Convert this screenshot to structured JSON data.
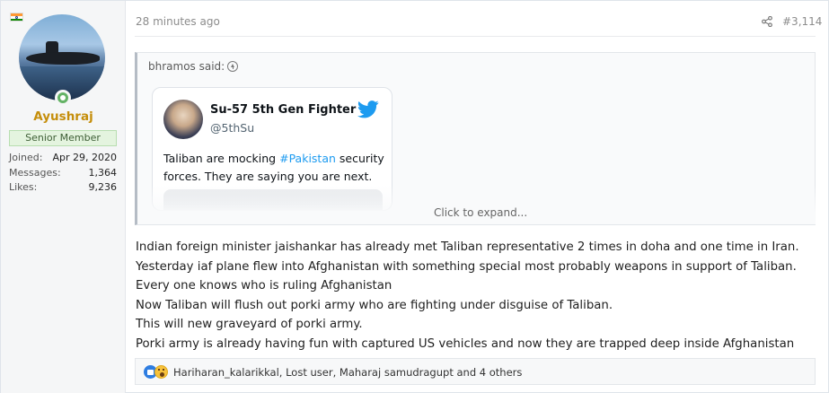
{
  "user": {
    "username": "Ayushraj",
    "title": "Senior Member",
    "stats": [
      {
        "label": "Joined:",
        "value": "Apr 29, 2020"
      },
      {
        "label": "Messages:",
        "value": "1,364"
      },
      {
        "label": "Likes:",
        "value": "9,236"
      }
    ],
    "flag": "india-flag-icon"
  },
  "post": {
    "time": "28 minutes ago",
    "number": "#3,114"
  },
  "quote": {
    "author_label": "bhramos said:",
    "tweet": {
      "name": "Su-57 5th Gen Fighter",
      "handle": "@5thSu",
      "text_pre": "Taliban are mocking ",
      "hashtag": "#Pakistan",
      "text_post": " security forces. They are saying you are next."
    },
    "expand_label": "Click to expand..."
  },
  "body": {
    "lines": [
      "Indian foreign minister jaishankar has already met Taliban representative 2 times in doha and one time in Iran.",
      "Yesterday iaf plane flew into Afghanistan with something special most probably weapons in support of Taliban.",
      "Every one knows who is ruling Afghanistan",
      "Now Taliban will flush out porki army who are fighting under disguise of Taliban.",
      "This will new graveyard of porki army.",
      "Porki army is already having fun with captured US vehicles and now they are trapped deep inside Afghanistan"
    ]
  },
  "reactions": {
    "text": "Hariharan_kalarikkal, Lost user, Maharaj samudragupt and 4 others"
  },
  "colors": {
    "username": "#c58e0b",
    "hashtag": "#1d9bf0",
    "twitter": "#1d9bf0",
    "online": "#63b265"
  }
}
